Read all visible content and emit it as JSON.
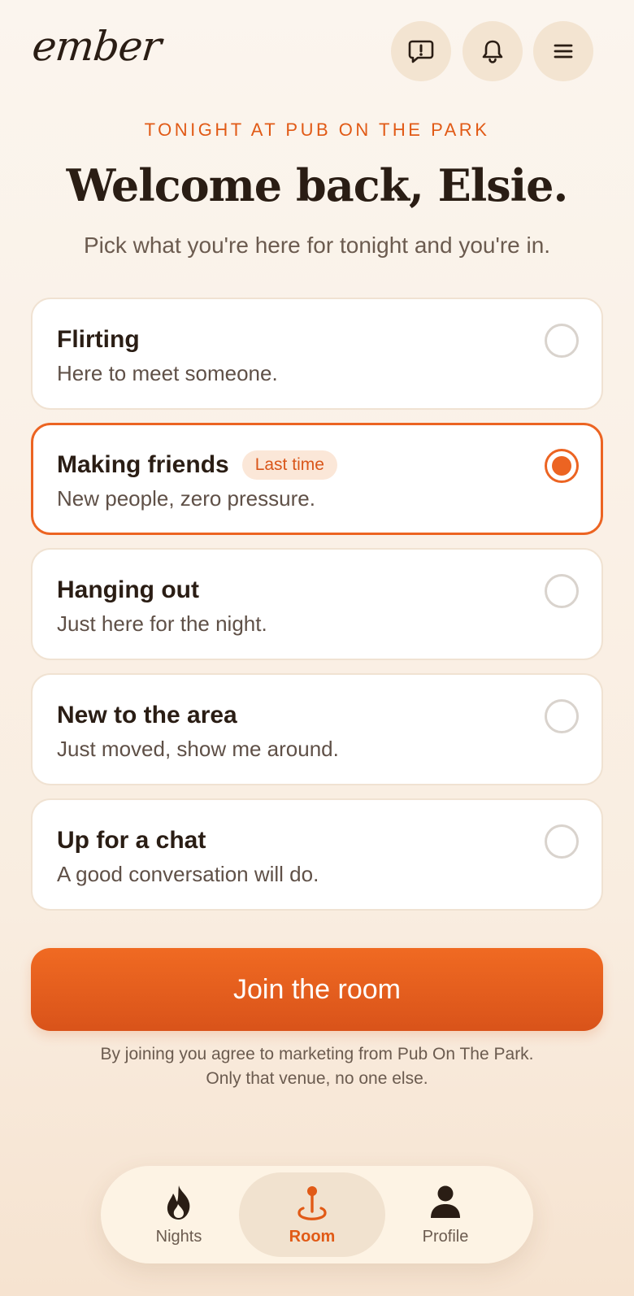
{
  "header": {
    "logo": "ember",
    "icons": [
      "report-icon",
      "bell-icon",
      "menu-icon"
    ]
  },
  "hero": {
    "eyebrow": "TONIGHT AT PUB ON THE PARK",
    "title": "Welcome back, Elsie.",
    "subtitle": "Pick what you're here for tonight and you're in."
  },
  "options": [
    {
      "title": "Flirting",
      "desc": "Here to meet someone.",
      "selected": false
    },
    {
      "title": "Making friends",
      "desc": "New people, zero pressure.",
      "badge": "Last time",
      "selected": true
    },
    {
      "title": "Hanging out",
      "desc": "Just here for the night.",
      "selected": false
    },
    {
      "title": "New to the area",
      "desc": "Just moved, show me around.",
      "selected": false
    },
    {
      "title": "Up for a chat",
      "desc": "A good conversation will do.",
      "selected": false
    }
  ],
  "cta": {
    "label": "Join the room"
  },
  "disclaimer": {
    "line1": "By joining you agree to marketing from Pub On The Park.",
    "line2": "Only that venue, no one else."
  },
  "tabs": [
    {
      "label": "Nights",
      "icon": "flame-icon",
      "active": false
    },
    {
      "label": "Room",
      "icon": "pin-icon",
      "active": true
    },
    {
      "label": "Profile",
      "icon": "person-icon",
      "active": false
    }
  ],
  "colors": {
    "accent": "#ec6422",
    "background": "#fbf5ee",
    "text": "#2a1d14"
  }
}
